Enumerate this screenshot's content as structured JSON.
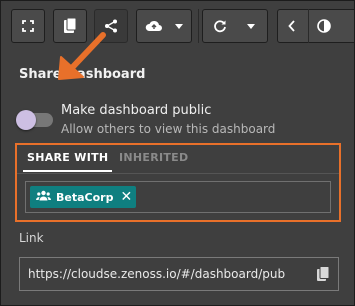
{
  "toolbar": {
    "buttons": [
      {
        "name": "fullscreen",
        "icon": "fullscreen-icon"
      },
      {
        "name": "clipboard",
        "icon": "clipboard-icon"
      },
      {
        "name": "share",
        "icon": "share-icon",
        "active": true
      },
      {
        "name": "cloud-save",
        "icon": "cloud-upload-icon"
      },
      {
        "name": "refresh",
        "icon": "refresh-icon"
      },
      {
        "name": "previous",
        "icon": "chevron-left-icon"
      },
      {
        "name": "time",
        "icon": "clock-icon"
      }
    ]
  },
  "panel": {
    "title": "Share Dashboard",
    "public_toggle": {
      "label": "Make dashboard public",
      "description": "Allow others to view this dashboard",
      "on": false
    },
    "tabs": [
      {
        "label": "SHARE WITH",
        "active": true
      },
      {
        "label": "INHERITED",
        "active": false
      }
    ],
    "shared_with": [
      {
        "label": "BetaCorp",
        "icon": "group-icon"
      }
    ],
    "link": {
      "label": "Link",
      "value": "https://cloudse.zenoss.io/#/dashboard/pub"
    }
  },
  "colors": {
    "background": "#3f3f3f",
    "highlight": "#e8702a",
    "chip": "#0f7f80",
    "toggle_knob": "#cdbfe3"
  }
}
